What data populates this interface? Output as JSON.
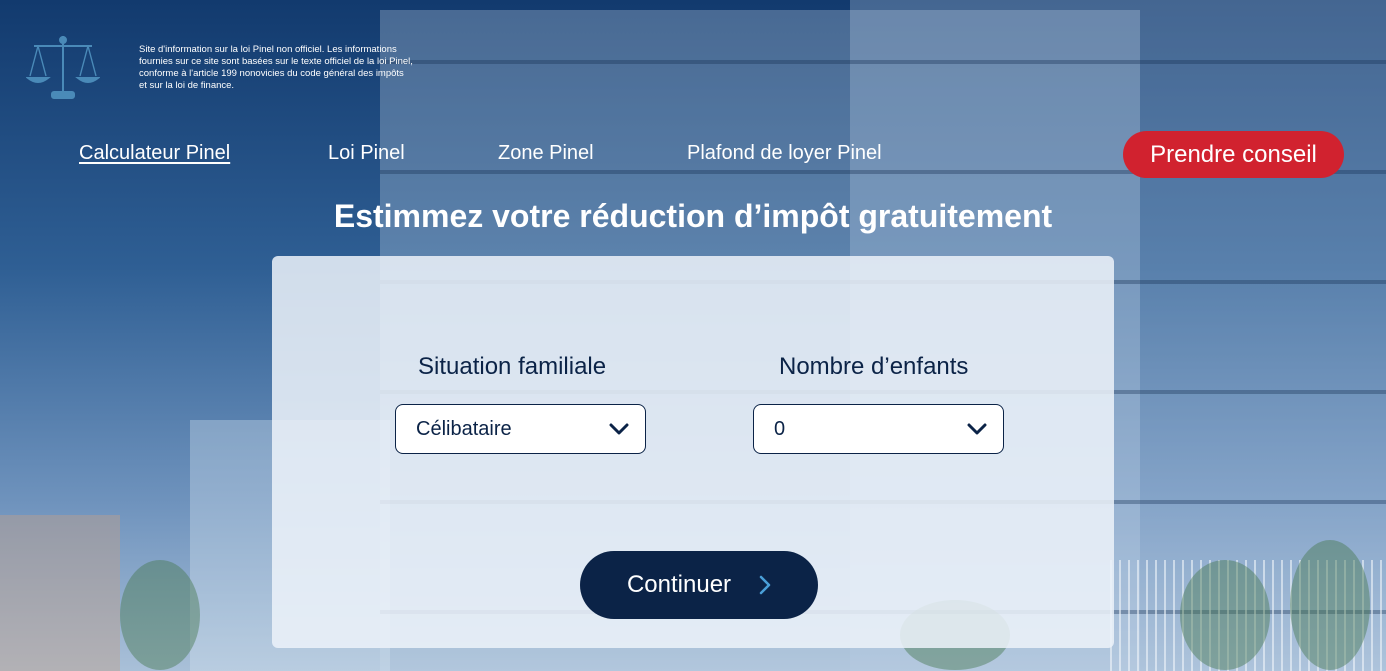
{
  "notice_text": "Site d'information sur la loi Pinel non officiel. Les informations fournies sur ce site sont basées sur le texte officiel de la loi Pinel, conforme à l'article 199 nonovicies du code général des impôts et sur la loi de finance.",
  "logo_icon": "scales-of-justice-icon",
  "nav": {
    "items": [
      {
        "label": "Calculateur Pinel",
        "active": true
      },
      {
        "label": "Loi Pinel"
      },
      {
        "label": "Zone Pinel"
      },
      {
        "label": "Plafond de loyer Pinel"
      }
    ],
    "cta_label": "Prendre conseil"
  },
  "headline": "Estimmez votre réduction d’impôt gratuitement",
  "form": {
    "situation": {
      "label": "Situation familiale",
      "value": "Célibataire"
    },
    "children": {
      "label": "Nombre d’enfants",
      "value": "0"
    },
    "continue_label": "Continuer"
  },
  "colors": {
    "accent_red": "#d1222f",
    "navy": "#0b2347",
    "logo_blue": "#4a8ab8"
  }
}
